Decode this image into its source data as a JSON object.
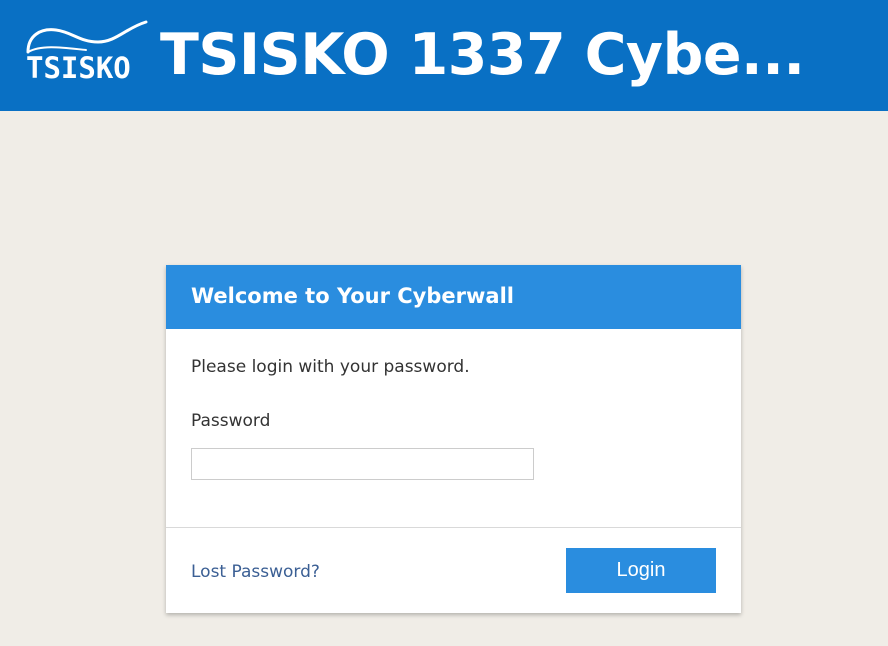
{
  "header": {
    "logo_text": "TSISKO",
    "title": "TSISKO 1337 Cybe...",
    "background_color": "#0970c4"
  },
  "card": {
    "title": "Welcome to Your Cyberwall",
    "instructions": "Please login with your password.",
    "password_label": "Password",
    "password_value": "",
    "password_placeholder": "",
    "lost_password_link": "Lost Password?",
    "login_button": "Login",
    "accent_color": "#2a8ddf"
  }
}
